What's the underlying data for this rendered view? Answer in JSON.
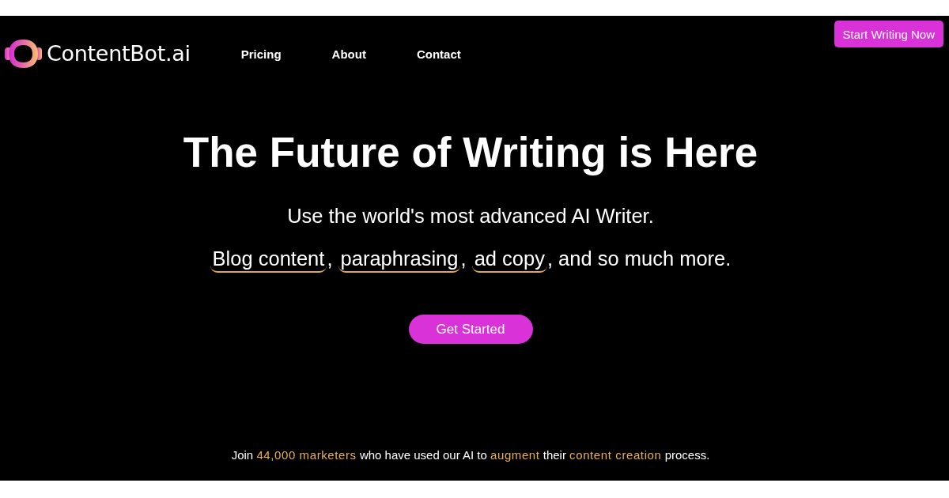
{
  "header": {
    "logo": {
      "text": "ContentBot.ai"
    },
    "nav": [
      "Pricing",
      "About",
      "Contact"
    ],
    "cta_button": "Start Writing Now"
  },
  "hero": {
    "title": "The Future of Writing is Here",
    "subtitle": "Use the world's most advanced AI Writer.",
    "features": [
      {
        "text": "Blog content",
        "kind": "highlight"
      },
      {
        "text": ",",
        "kind": "plain"
      },
      {
        "text": "paraphrasing",
        "kind": "highlight"
      },
      {
        "text": ",",
        "kind": "plain"
      },
      {
        "text": "ad copy",
        "kind": "highlight"
      },
      {
        "text": ", and so much more.",
        "kind": "plain"
      }
    ],
    "button": "Get Started"
  },
  "footer_note": [
    {
      "text": "Join",
      "accent": false
    },
    {
      "text": "44,000 marketers",
      "accent": true
    },
    {
      "text": "who have used our AI to",
      "accent": false
    },
    {
      "text": "augment",
      "accent": true
    },
    {
      "text": "their",
      "accent": false
    },
    {
      "text": "content creation",
      "accent": true
    },
    {
      "text": "process.",
      "accent": false
    }
  ]
}
